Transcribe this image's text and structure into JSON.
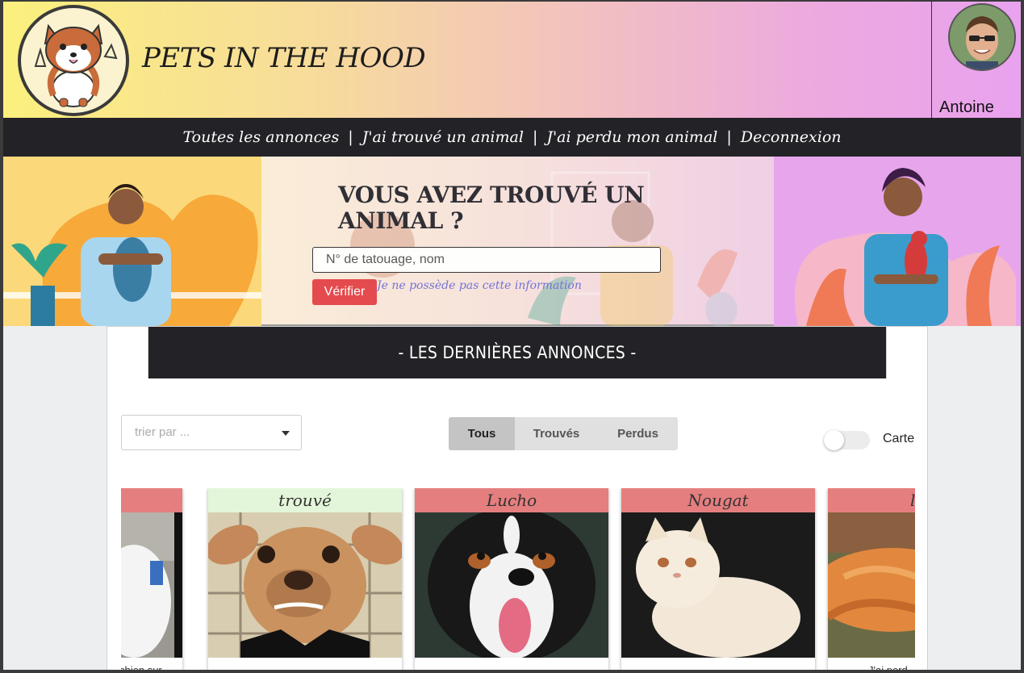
{
  "header": {
    "site_title": "PETS IN THE HOOD",
    "user_name": "Antoine"
  },
  "nav": {
    "items": [
      "Toutes les annonces",
      "J'ai trouvé un animal",
      "J'ai perdu mon animal",
      "Deconnexion"
    ],
    "separator": "|"
  },
  "hero": {
    "title": "VOUS AVEZ TROUVÉ UN ANIMAL ?",
    "input_placeholder": "N° de tatouage, nom",
    "verify_label": "Vérifier",
    "no_info_link": "Je ne possède pas cette information"
  },
  "listing": {
    "heading": "- LES DERNIÈRES ANNONCES -",
    "sort_placeholder": "trier par ...",
    "filters": [
      "Tous",
      "Trouvés",
      "Perdus"
    ],
    "active_filter": "Tous",
    "map_toggle_label": "Carte",
    "cards": [
      {
        "title": "",
        "status": "lost",
        "caption": "chien sur"
      },
      {
        "title": "trouvé",
        "status": "found",
        "caption": ""
      },
      {
        "title": "Lucho",
        "status": "lost",
        "caption": ""
      },
      {
        "title": "Nougat",
        "status": "lost",
        "caption": ""
      },
      {
        "title": "l",
        "status": "lost",
        "caption": "J'ai perd"
      }
    ]
  },
  "colors": {
    "lost_header": "#e57e7f",
    "found_header": "#e4f6d9",
    "nav_bg": "#232227",
    "button_red": "#e4474a"
  }
}
